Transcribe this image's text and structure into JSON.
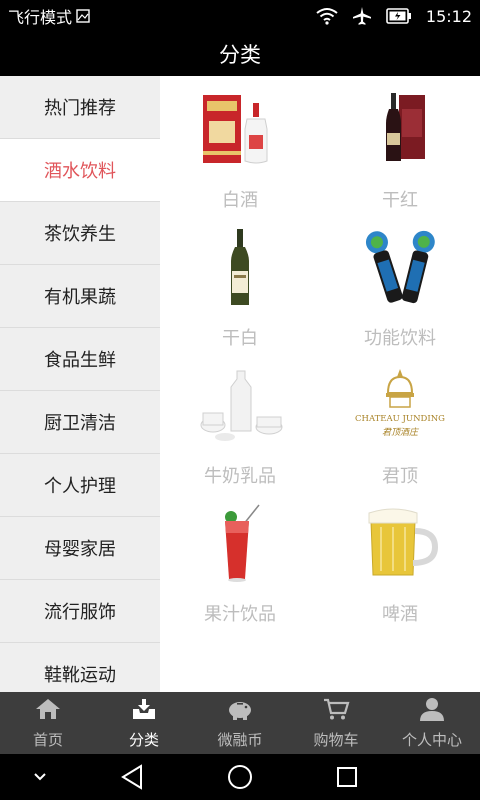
{
  "status_bar": {
    "left_label": "飞行模式",
    "time": "15:12",
    "icons": [
      "image-icon",
      "wifi-icon",
      "airplane-icon",
      "battery-icon"
    ]
  },
  "header": {
    "title": "分类"
  },
  "sidebar": {
    "items": [
      {
        "label": "热门推荐"
      },
      {
        "label": "酒水饮料"
      },
      {
        "label": "茶饮养生"
      },
      {
        "label": "有机果蔬"
      },
      {
        "label": "食品生鲜"
      },
      {
        "label": "厨卫清洁"
      },
      {
        "label": "个人护理"
      },
      {
        "label": "母婴家居"
      },
      {
        "label": "流行服饰"
      },
      {
        "label": "鞋靴运动"
      }
    ],
    "active_label": "酒水饮料"
  },
  "products": [
    {
      "label": "白酒",
      "image": "baijiu-gift-box"
    },
    {
      "label": "干红",
      "image": "red-wine-bottle-box"
    },
    {
      "label": "干白",
      "image": "white-wine-bottle"
    },
    {
      "label": "功能饮料",
      "image": "sports-drink-bottles"
    },
    {
      "label": "牛奶乳品",
      "image": "milk-jug-and-cups"
    },
    {
      "label": "君顶",
      "image": "chateau-junding-logo",
      "logo_text": "CHATEAU JUNDING",
      "logo_cn": "君顶酒庄"
    },
    {
      "label": "果汁饮品",
      "image": "juice-glass"
    },
    {
      "label": "啤酒",
      "image": "beer-mug"
    }
  ],
  "tabbar": {
    "tabs": [
      {
        "label": "首页",
        "icon": "home-icon"
      },
      {
        "label": "分类",
        "icon": "category-download-icon"
      },
      {
        "label": "微融币",
        "icon": "piggy-bank-icon"
      },
      {
        "label": "购物车",
        "icon": "cart-icon"
      },
      {
        "label": "个人中心",
        "icon": "person-icon"
      }
    ],
    "active_label": "分类"
  },
  "navbar": {
    "icons": [
      "chevron-down-icon",
      "back-icon",
      "home-circle-icon",
      "recents-icon"
    ]
  },
  "colors": {
    "accent": "#e0555a",
    "bars": "#000000",
    "tabbar_bg": "#3d3d3d",
    "sidebar_bg": "#efefef",
    "product_label": "#bdbdbd"
  }
}
